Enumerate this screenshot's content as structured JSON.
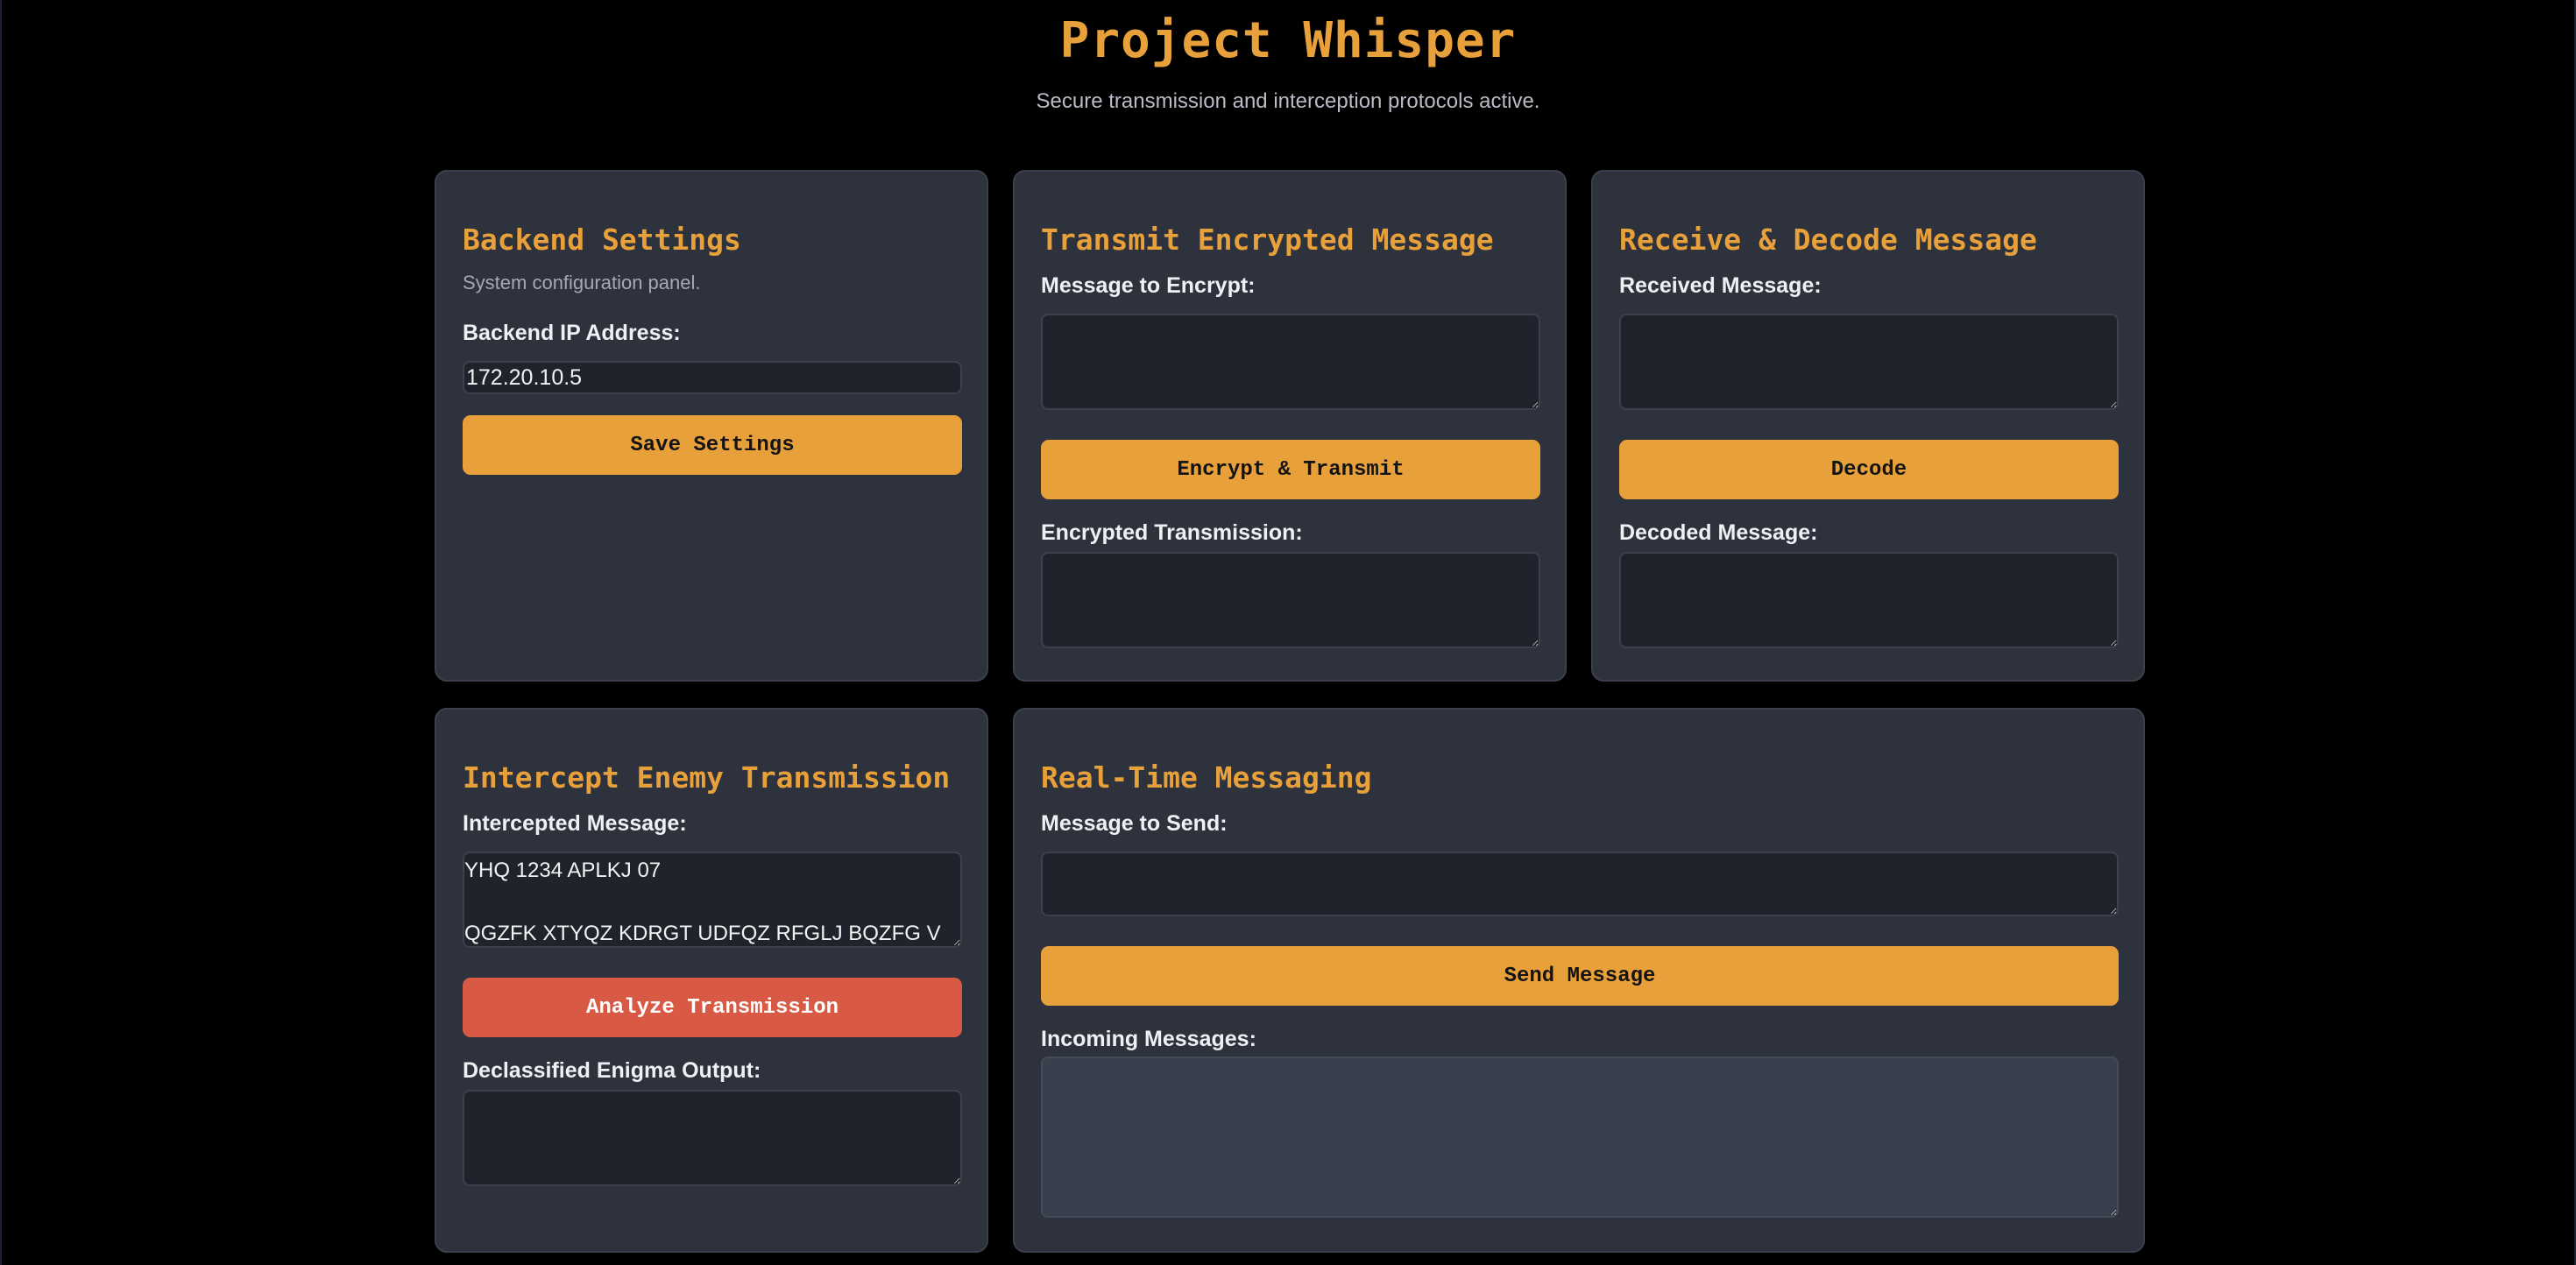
{
  "app": {
    "title": "Project Whisper",
    "subtitle": "Secure transmission and interception protocols active."
  },
  "backend": {
    "title": "Backend Settings",
    "description": "System configuration panel.",
    "ip_label": "Backend IP Address:",
    "ip_value": "172.20.10.5",
    "save_label": "Save Settings"
  },
  "transmit": {
    "title": "Transmit Encrypted Message",
    "message_label": "Message to Encrypt:",
    "message_value": "",
    "button_label": "Encrypt & Transmit",
    "output_label": "Encrypted Transmission:",
    "output_value": ""
  },
  "receive": {
    "title": "Receive & Decode Message",
    "message_label": "Received Message:",
    "message_value": "",
    "button_label": "Decode",
    "output_label": "Decoded Message:",
    "output_value": ""
  },
  "intercept": {
    "title": "Intercept Enemy Transmission",
    "message_label": "Intercepted Message:",
    "message_value": "YHQ 1234 APLKJ 07\n\nQGZFK XTYQZ KDRGT UDFQZ RFGLJ BQZFG V",
    "button_label": "Analyze Transmission",
    "output_label": "Declassified Enigma Output:",
    "output_value": ""
  },
  "messaging": {
    "title": "Real-Time Messaging",
    "message_label": "Message to Send:",
    "message_value": "",
    "button_label": "Send Message",
    "incoming_label": "Incoming Messages:",
    "incoming_value": ""
  },
  "colors": {
    "accent": "#e8a03b",
    "danger": "#d85a45",
    "card_bg": "#2e323d",
    "page_bg": "#000000"
  }
}
